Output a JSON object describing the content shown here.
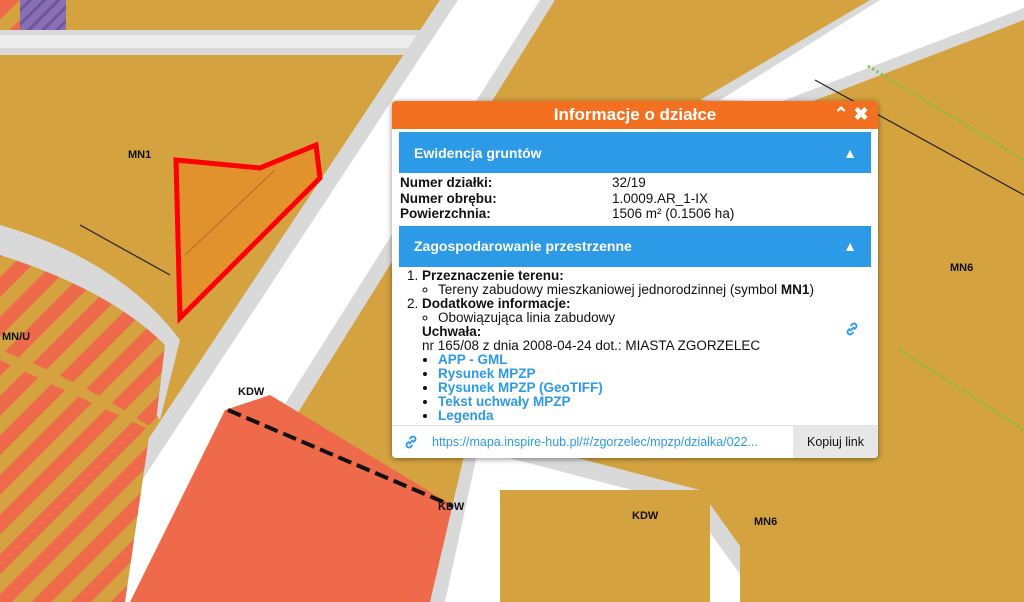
{
  "map": {
    "labels": {
      "mn1": "MN1",
      "mnu": "MN/U",
      "kdw_top": "KDW",
      "kdw_mid": "KDW",
      "kdw_right": "KDW",
      "mn6_top": "MN6",
      "mn6_bottom": "MN6"
    },
    "colors": {
      "residential": "#d4a23f",
      "mixed_stripes": "#ee6a4b",
      "kdw_zone": "#ee6a4b",
      "road": "#ffffff",
      "sidewalk": "#d9d9d9",
      "selected_parcel": "#ff0000",
      "planned_purple": "#8a6fb4",
      "green_line": "#7bc043"
    }
  },
  "popup": {
    "title": "Informacje o działce",
    "sections": {
      "cadastre": {
        "title": "Ewidencja gruntów",
        "rows": [
          {
            "label": "Numer działki:",
            "value": "32/19"
          },
          {
            "label": "Numer obrębu:",
            "value": "1.0009.AR_1-IX"
          },
          {
            "label": "Powierzchnia:",
            "value": "1506 m² (0.1506 ha)"
          }
        ]
      },
      "planning": {
        "title": "Zagospodarowanie przestrzenne",
        "item1_title": "Przeznaczenie terenu:",
        "item1_text": "Tereny zabudowy mieszkaniowej jednorodzinnej (symbol ",
        "item1_symbol": "MN1",
        "item1_close": ")",
        "item2_title": "Dodatkowe informacje:",
        "item2_text": "Obowiązująca linia zabudowy",
        "resolution_label": "Uchwała:",
        "resolution_text": "nr 165/08 z dnia 2008-04-24 dot.: MIASTA ZGORZELEC",
        "links": [
          "APP - GML",
          "Rysunek MPZP",
          "Rysunek MPZP (GeoTIFF)",
          "Tekst uchwały MPZP",
          "Legenda"
        ]
      }
    },
    "url": "https://mapa.inspire-hub.pl/#/zgorzelec/mpzp/dzialka/022...",
    "copy_label": "Kopiuj link"
  }
}
